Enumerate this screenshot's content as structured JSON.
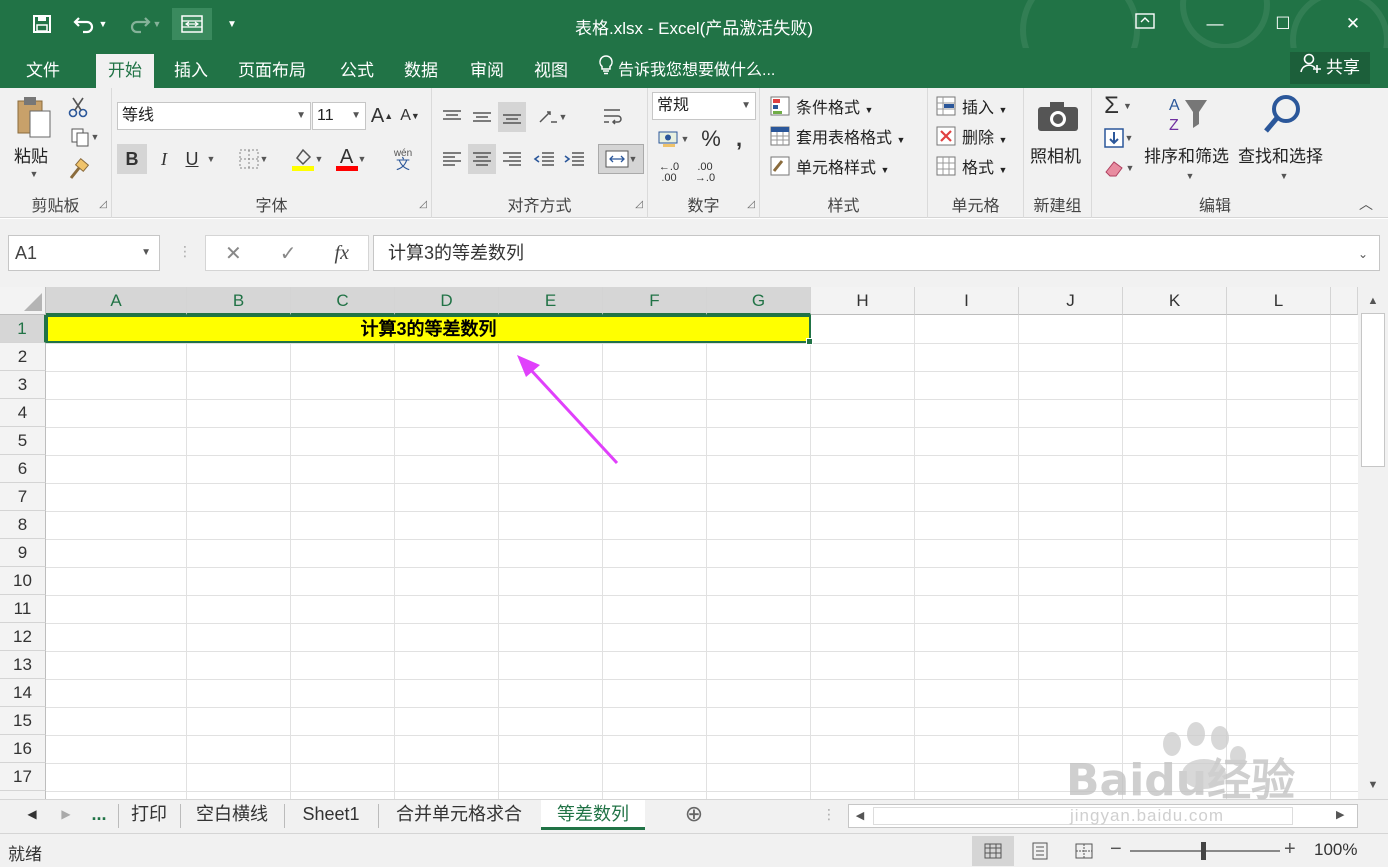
{
  "titlebar": {
    "title": "表格.xlsx - Excel(产品激活失败)",
    "save_icon": "save-icon",
    "undo_icon": "undo-icon",
    "redo_icon": "redo-icon",
    "minimize": "—",
    "maximize": "☐",
    "close": "✕",
    "restore_icon": "ribbon-display-icon"
  },
  "tabs": {
    "file": "文件",
    "home": "开始",
    "insert": "插入",
    "layout": "页面布局",
    "formulas": "公式",
    "data": "数据",
    "review": "审阅",
    "view": "视图",
    "tellme": "告诉我您想要做什么...",
    "share": "共享"
  },
  "ribbon": {
    "clipboard": {
      "label": "剪贴板",
      "paste": "粘贴"
    },
    "font": {
      "label": "字体",
      "font_name": "等线",
      "font_size": "11",
      "bold": "B",
      "italic": "I",
      "underline": "U",
      "grow": "A",
      "shrink": "A",
      "wen": "wén",
      "wen2": "文",
      "fontcolor": "A"
    },
    "alignment": {
      "label": "对齐方式"
    },
    "number": {
      "label": "数字",
      "format": "常规",
      "percent": "%",
      "comma": ",",
      "inc": "←.0\n.00",
      "dec": ".00\n→.0"
    },
    "styles": {
      "label": "样式",
      "conditional": "条件格式",
      "table": "套用表格格式",
      "cell": "单元格样式"
    },
    "cells": {
      "label": "单元格",
      "insert": "插入",
      "delete": "删除",
      "format": "格式"
    },
    "camera": {
      "label": "新建组",
      "camera": "照相机"
    },
    "editing": {
      "label": "编辑",
      "sum": "Σ",
      "sort": "排序和筛选",
      "find": "查找和选择"
    }
  },
  "formula_bar": {
    "name_box": "A1",
    "cancel": "✕",
    "enter": "✓",
    "fx": "fx",
    "formula": "计算3的等差数列"
  },
  "grid": {
    "columns": [
      "A",
      "B",
      "C",
      "D",
      "E",
      "F",
      "G",
      "H",
      "I",
      "J",
      "K",
      "L"
    ],
    "rows": [
      "1",
      "2",
      "3",
      "4",
      "5",
      "6",
      "7",
      "8",
      "9",
      "10",
      "11",
      "12",
      "13",
      "14",
      "15",
      "16",
      "17"
    ],
    "a1_value": "计算3的等差数列",
    "fill_color": "#ffff00",
    "arrow_color": "#e040fb"
  },
  "sheets": {
    "more": "...",
    "tabs": [
      "打印",
      "空白横线",
      "Sheet1",
      "合并单元格求合",
      "等差数列"
    ],
    "add": "⊕"
  },
  "status": {
    "ready": "就绪",
    "zoom": "100%",
    "minus": "−",
    "plus": "+"
  },
  "watermark": {
    "brand": "Baidu经验",
    "url": "jingyan.baidu.com"
  },
  "colors": {
    "accent": "#217346",
    "highlight": "#ffff00",
    "arrow": "#e040fb"
  }
}
